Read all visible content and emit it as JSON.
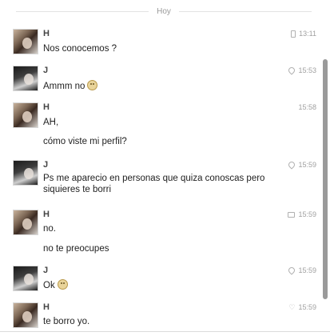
{
  "day_label": "Hoy",
  "messages": [
    {
      "sender": "H",
      "avatar": "h",
      "time": "13:11",
      "status_icon": "phone-icon",
      "lines": [
        "Nos conocemos ?"
      ]
    },
    {
      "sender": "J",
      "avatar": "j",
      "time": "15:53",
      "status_icon": "location-pin-icon",
      "lines": [
        "Ammm no"
      ],
      "emoji": "smiley-icon"
    },
    {
      "sender": "H",
      "avatar": "h",
      "time": "15:58",
      "status_icon": "",
      "lines": [
        "AH,",
        "cómo viste mi perfil?"
      ]
    },
    {
      "sender": "J",
      "avatar": "j",
      "time": "15:59",
      "status_icon": "location-pin-icon",
      "lines": [
        "Ps me aparecio en personas que quiza conoscas pero siquieres te borri"
      ]
    },
    {
      "sender": "H",
      "avatar": "h",
      "time": "15:59",
      "status_icon": "chat-icon",
      "lines": [
        "no.",
        "no te preocupes"
      ]
    },
    {
      "sender": "J",
      "avatar": "j",
      "time": "15:59",
      "status_icon": "location-pin-icon",
      "lines": [
        "Ok"
      ],
      "emoji": "smiley-icon"
    },
    {
      "sender": "H",
      "avatar": "h",
      "time": "15:59",
      "status_icon": "heart-icon",
      "lines": [
        "te borro yo."
      ]
    }
  ]
}
